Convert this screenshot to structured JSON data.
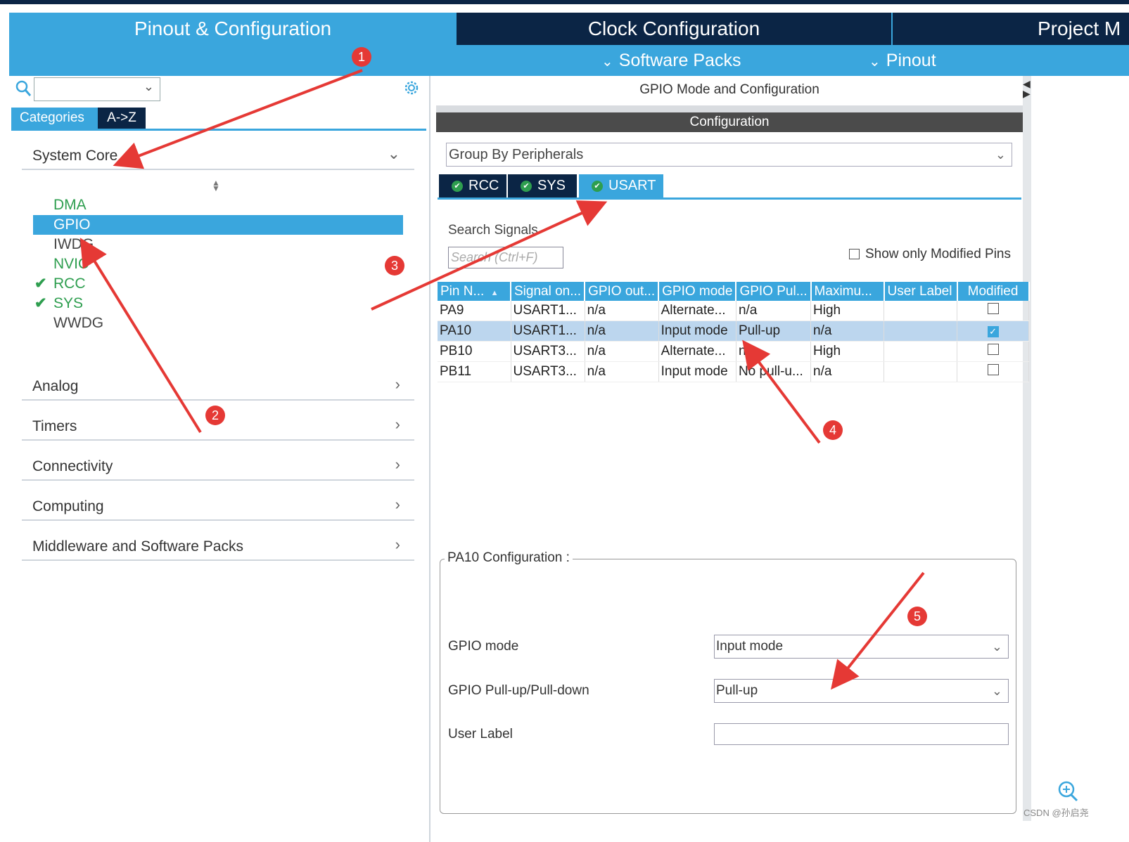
{
  "header": {
    "tabs": [
      "Pinout & Configuration",
      "Clock Configuration",
      "Project M"
    ],
    "subnav": [
      "Software Packs",
      "Pinout"
    ]
  },
  "left": {
    "category_tabs": [
      "Categories",
      "A->Z"
    ],
    "sections": [
      "System Core",
      "Analog",
      "Timers",
      "Connectivity",
      "Computing",
      "Middleware and Software Packs"
    ],
    "system_core_items": [
      {
        "label": "DMA",
        "color": "#2e9e4f",
        "checked": false
      },
      {
        "label": "GPIO",
        "color": "#ffffff",
        "checked": false,
        "selected": true
      },
      {
        "label": "IWDG",
        "color": "#444444",
        "checked": false
      },
      {
        "label": "NVIC",
        "color": "#2e9e4f",
        "checked": false
      },
      {
        "label": "RCC",
        "color": "#2e9e4f",
        "checked": true
      },
      {
        "label": "SYS",
        "color": "#2e9e4f",
        "checked": true
      },
      {
        "label": "WWDG",
        "color": "#444444",
        "checked": false
      }
    ]
  },
  "right": {
    "title": "GPIO Mode and Configuration",
    "config_bar": "Configuration",
    "group_by": "Group By Peripherals",
    "periph_tabs": [
      "RCC",
      "SYS",
      "USART"
    ],
    "search_label": "Search Signals",
    "search_placeholder": "Search (Ctrl+F)",
    "show_modified": "Show only Modified Pins",
    "table": {
      "headers": [
        "Pin N...",
        "Signal on...",
        "GPIO out...",
        "GPIO mode",
        "GPIO Pul...",
        "Maximu...",
        "User Label",
        "Modified"
      ],
      "rows": [
        {
          "pin": "PA9",
          "signal": "USART1...",
          "out": "n/a",
          "mode": "Alternate...",
          "pull": "n/a",
          "max": "High",
          "label": "",
          "modified": false
        },
        {
          "pin": "PA10",
          "signal": "USART1...",
          "out": "n/a",
          "mode": "Input mode",
          "pull": "Pull-up",
          "max": "n/a",
          "label": "",
          "modified": true
        },
        {
          "pin": "PB10",
          "signal": "USART3...",
          "out": "n/a",
          "mode": "Alternate...",
          "pull": "n/a",
          "max": "High",
          "label": "",
          "modified": false
        },
        {
          "pin": "PB11",
          "signal": "USART3...",
          "out": "n/a",
          "mode": "Input mode",
          "pull": "No pull-u...",
          "max": "n/a",
          "label": "",
          "modified": false
        }
      ]
    },
    "pin_config": {
      "title": "PA10 Configuration :",
      "gpio_mode_label": "GPIO mode",
      "gpio_mode_value": "Input mode",
      "pull_label": "GPIO Pull-up/Pull-down",
      "pull_value": "Pull-up",
      "user_label_label": "User Label",
      "user_label_value": ""
    }
  },
  "annotations": [
    "1",
    "2",
    "3",
    "4",
    "5"
  ],
  "watermark": "CSDN @孙启尧",
  "colors": {
    "accent": "#3aa6dd",
    "dark": "#0b2545",
    "ok": "#2e9e4f",
    "arrow": "#e53935"
  }
}
